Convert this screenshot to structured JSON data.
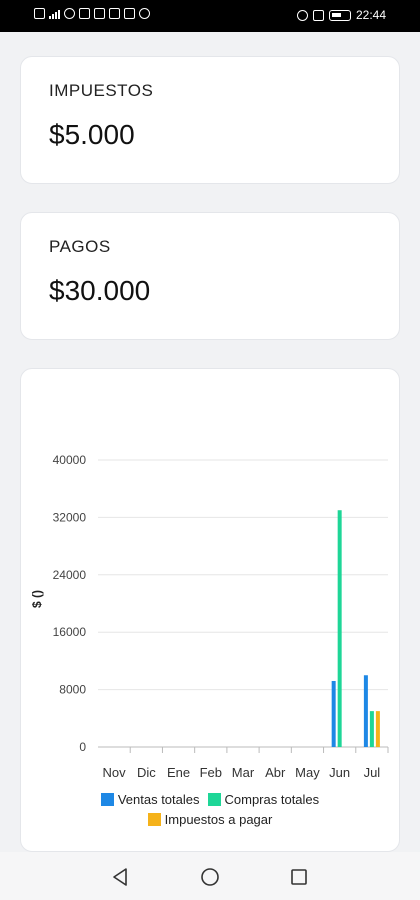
{
  "status_bar": {
    "time": "22:44"
  },
  "cards": [
    {
      "title": "IMPUESTOS",
      "value": "$5.000"
    },
    {
      "title": "PAGOS",
      "value": "$30.000"
    }
  ],
  "chart_data": {
    "type": "bar",
    "ylabel": "$ ()",
    "xlabel": "",
    "ylim": [
      0,
      40000
    ],
    "yticks": [
      0,
      8000,
      16000,
      24000,
      32000,
      40000
    ],
    "categories": [
      "Nov",
      "Dic",
      "Ene",
      "Feb",
      "Mar",
      "Abr",
      "May",
      "Jun",
      "Jul"
    ],
    "series": [
      {
        "name": "Ventas totales",
        "color": "#1e88e5",
        "values": [
          0,
          0,
          0,
          0,
          0,
          0,
          0,
          9200,
          10000
        ]
      },
      {
        "name": "Compras totales",
        "color": "#1ed697",
        "values": [
          0,
          0,
          0,
          0,
          0,
          0,
          0,
          33000,
          5000
        ]
      },
      {
        "name": "Impuestos a pagar",
        "color": "#f5b21a",
        "values": [
          0,
          0,
          0,
          0,
          0,
          0,
          0,
          0,
          5000
        ]
      }
    ],
    "grid": true,
    "legend_position": "bottom"
  },
  "nav": {
    "back_icon": "back-triangle-icon",
    "home_icon": "home-circle-icon",
    "recents_icon": "recents-square-icon"
  }
}
